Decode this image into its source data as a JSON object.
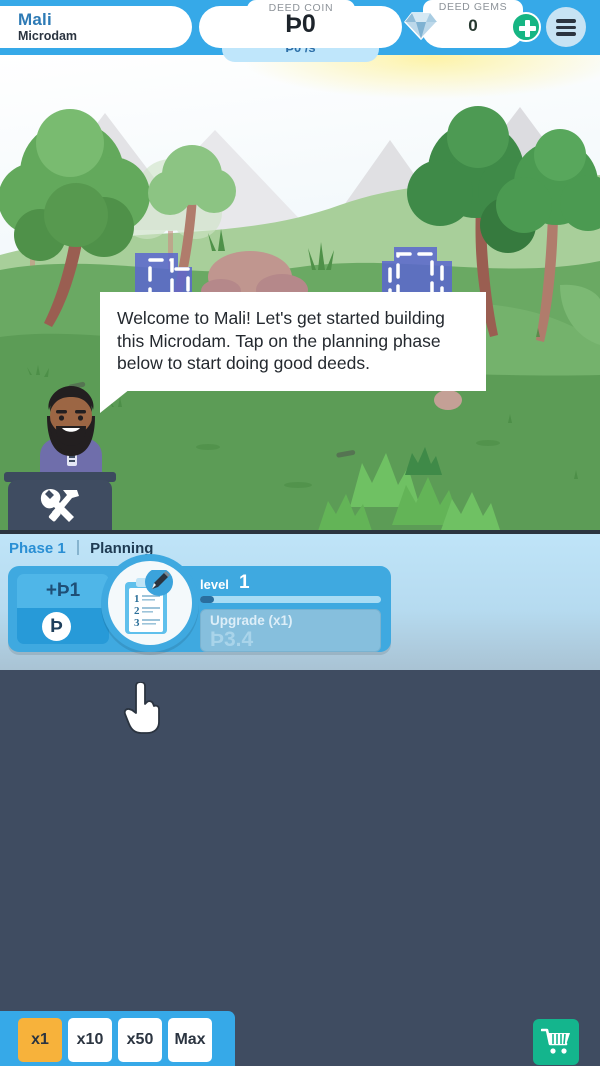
{
  "topbar": {
    "place_name": "Mali",
    "place_sub": "Microdam",
    "coin_label": "DEED COIN",
    "coin_amount": "Þ0",
    "coin_rate": "Þ0 /s",
    "gem_label": "DEED GEMS",
    "gem_count": "0",
    "gem_icon": "diamond-icon",
    "gem_add_icon": "plus-icon",
    "menu_icon": "hamburger-menu-icon"
  },
  "scene": {
    "tutorial_text": "Welcome to Mali! Let's get started building this Microdam. Tap on the planning phase below to start doing good deeds.",
    "character": "advisor-avatar",
    "tools_icon": "hammer-wrench-icon",
    "structure": "dam-blueprint-outline"
  },
  "phase": {
    "number_label": "Phase 1",
    "name_label": "Planning",
    "card": {
      "tap_gain": "+Þ1",
      "coin_symbol": "Þ",
      "icon": "clipboard-pencil-icon",
      "level_word": "level",
      "level_value": "1",
      "progress_percent": 8,
      "upgrade_label": "Upgrade (x1)",
      "upgrade_price": "Þ3.4"
    }
  },
  "cursor": {
    "icon": "pointing-hand-cursor"
  },
  "bottombar": {
    "multipliers": [
      {
        "label": "x1",
        "active": true
      },
      {
        "label": "x10",
        "active": false
      },
      {
        "label": "x50",
        "active": false
      },
      {
        "label": "Max",
        "active": false
      }
    ],
    "shop_icon": "shopping-cart-icon"
  },
  "colors": {
    "brand_blue": "#36a9e8",
    "dark_slate": "#3f4c61",
    "accent_orange": "#f7b23b",
    "shop_teal": "#14b58d",
    "gem_green": "#16b583"
  }
}
